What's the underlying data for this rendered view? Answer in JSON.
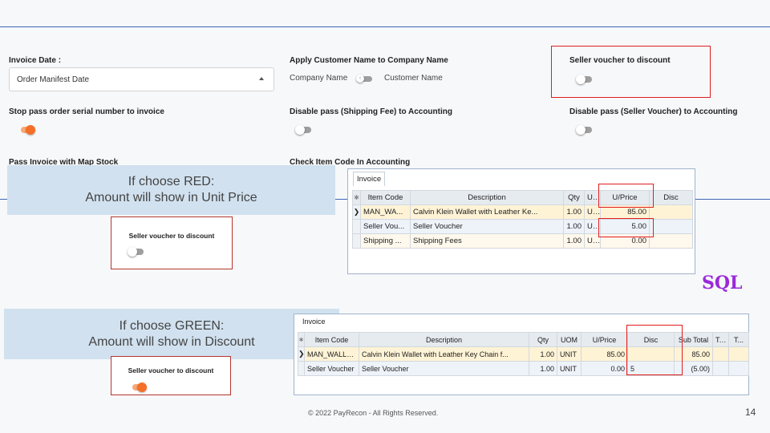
{
  "settings": {
    "invoice_date": {
      "label": "Invoice Date :",
      "value": "Order Manifest Date"
    },
    "apply_customer_name": {
      "label": "Apply Customer Name to Company Name",
      "left_option": "Company Name",
      "right_option": "Customer Name"
    },
    "seller_voucher_discount": {
      "label": "Seller voucher to discount"
    },
    "stop_pass_serial": {
      "label": "Stop pass order serial number to invoice"
    },
    "disable_shipping_fee": {
      "label": "Disable pass (Shipping Fee) to Accounting"
    },
    "disable_seller_voucher": {
      "label": "Disable pass (Seller Voucher) to Accounting"
    },
    "pass_invoice_map_stock": {
      "label": "Pass Invoice with Map Stock"
    },
    "check_item_code": {
      "label": "Check Item Code In Accounting"
    }
  },
  "callout_red": {
    "line1": "If choose RED:",
    "line2": "Amount will show in Unit Price",
    "card_label": "Seller voucher to discount"
  },
  "callout_green": {
    "line1": "If choose GREEN:",
    "line2": "Amount will show in Discount",
    "card_label": "Seller voucher to discount"
  },
  "invoice_red": {
    "tab": "Invoice",
    "columns": [
      "Item Code",
      "Description",
      "Qty",
      "U...",
      "U/Price",
      "Disc"
    ],
    "rows": [
      [
        "MAN_WA...",
        "Calvin Klein Wallet with Leather Ke...",
        "1.00",
        "U...",
        "85.00",
        ""
      ],
      [
        "Seller Vou...",
        "Seller Voucher",
        "1.00",
        "U...",
        "5.00",
        ""
      ],
      [
        "Shipping ...",
        "Shipping Fees",
        "1.00",
        "U...",
        "0.00",
        ""
      ]
    ]
  },
  "invoice_green": {
    "tab": "Invoice",
    "columns": [
      "Item Code",
      "Description",
      "Qty",
      "UOM",
      "U/Price",
      "Disc",
      "Sub Total",
      "Tax",
      "T..."
    ],
    "rows": [
      [
        "MAN_WALL_...",
        "Calvin Klein Wallet with Leather Key Chain f...",
        "1.00",
        "UNIT",
        "85.00",
        "",
        "85.00",
        "",
        ""
      ],
      [
        "Seller Voucher",
        "Seller Voucher",
        "1.00",
        "UNIT",
        "0.00",
        "5",
        "(5.00)",
        "",
        ""
      ]
    ]
  },
  "brand": "SQL",
  "footer": "© 2022 PayRecon - All Rights Reserved.",
  "page_number": "14",
  "colors": {
    "accent_red": "#e11d1d",
    "toggle_on": "#f36f28",
    "callout_bg": "#d1e1ef",
    "sql_purple": "#9a2ad8",
    "rule_blue": "#3f67b3"
  }
}
